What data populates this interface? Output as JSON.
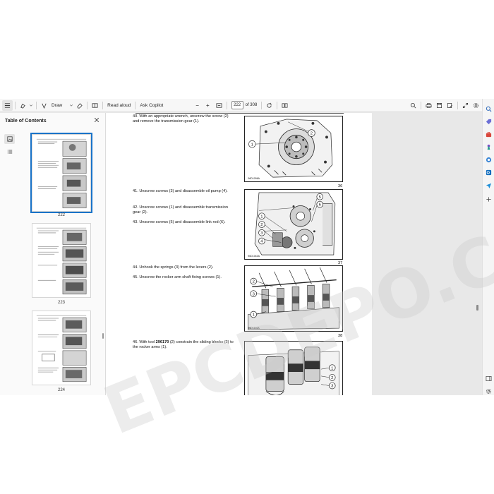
{
  "toolbar": {
    "draw_label": "Draw",
    "read_aloud_label": "Read aloud",
    "ask_copilot_label": "Ask Copilot",
    "zoom_out": "−",
    "zoom_in": "+",
    "current_page": "222",
    "page_of": "of 308"
  },
  "sidebar": {
    "title": "Table of Contents",
    "thumbnails": [
      {
        "label": "222"
      },
      {
        "label": "223"
      },
      {
        "label": "224"
      }
    ]
  },
  "document": {
    "steps": [
      {
        "number": "40.",
        "text": "With an appropriate wrench, unscrew the screw (2) and remove the transmission gear (1)."
      },
      {
        "number": "41.",
        "text": "Unscrew screws (3) and disassemble oil pump (4)."
      },
      {
        "number": "42.",
        "text": "Unscrew screws (1) and disassemble transmission gear (2)."
      },
      {
        "number": "43.",
        "text": "Unscrew screws (5) and disassemble link rod (6)."
      },
      {
        "number": "44.",
        "text": "Unhook the springs (3) from the levers (2)."
      },
      {
        "number": "45.",
        "text": "Unscrew the rocker arm shaft fixing screws (1)."
      },
      {
        "number": "46.",
        "text_before": "With tool ",
        "tool": "296170",
        "text_after": " (2) constrain the sliding blocks (3) to the rocker arms (1)."
      }
    ],
    "figures": [
      {
        "number": "36",
        "code": "96D1096A",
        "callouts": [
          "1",
          "2"
        ]
      },
      {
        "number": "37",
        "code": "96D1043A",
        "callouts": [
          "5",
          "6",
          "1",
          "2",
          "3",
          "4"
        ]
      },
      {
        "number": "38",
        "code": "96D1166A",
        "callouts": [
          "2",
          "3",
          "1"
        ]
      },
      {
        "number": "",
        "code": "",
        "callouts": [
          "1",
          "2",
          "3"
        ]
      }
    ]
  },
  "watermark": "EPCDEPO.COM",
  "colors": {
    "selection": "#1a73c8",
    "toolbar_bg": "#f7f7f7",
    "canvas_bg": "#e8e8e8"
  }
}
